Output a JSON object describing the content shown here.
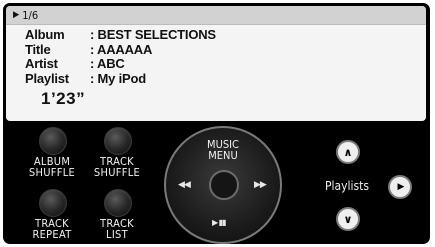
{
  "display": {
    "track_position": "1/6",
    "rows": [
      {
        "label": "Album",
        "value": ": BEST SELECTIONS"
      },
      {
        "label": "Title",
        "value": ": AAAAAA"
      },
      {
        "label": "Artist",
        "value": ": ABC"
      },
      {
        "label": "Playlist",
        "value": ": My iPod"
      }
    ],
    "elapsed_time": "1’23”"
  },
  "controls": {
    "album_shuffle": "ALBUM\nSHUFFLE",
    "track_shuffle": "TRACK\nSHUFFLE",
    "track_repeat": "TRACK\nREPEAT",
    "track_list": "TRACK\nLIST",
    "music_menu": "MUSIC\nMENU",
    "playlists": "Playlists",
    "prev_glyph": "◀◀",
    "next_glyph": "▶▶",
    "play_pause_glyph": "▶ ▮▮",
    "up_glyph": "∧",
    "down_glyph": "∨",
    "right_glyph": "▶"
  }
}
